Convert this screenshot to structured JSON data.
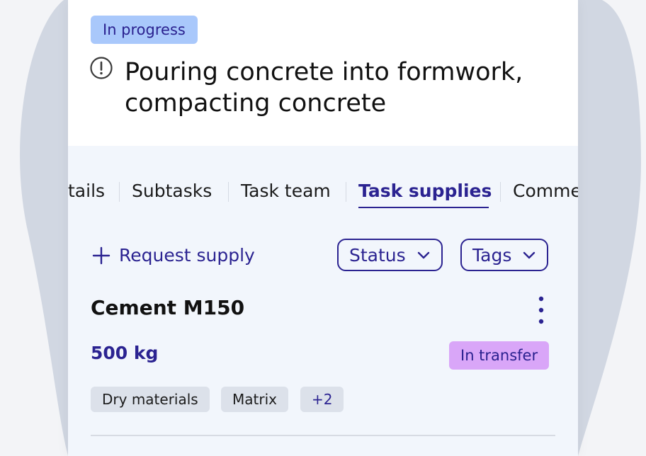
{
  "task": {
    "status": "In progress",
    "title": "Pouring concrete into formwork, compacting concrete"
  },
  "tabs": [
    {
      "label": "tails"
    },
    {
      "label": "Subtasks"
    },
    {
      "label": "Task team"
    },
    {
      "label": "Task supplies",
      "active": true
    },
    {
      "label": "Comme"
    }
  ],
  "toolbar": {
    "request_supply": "Request supply",
    "status_filter": "Status",
    "tags_filter": "Tags"
  },
  "supply": {
    "name": "Cement M150",
    "quantity": "500 kg",
    "status": "In transfer",
    "tags": [
      "Dry materials",
      "Matrix"
    ],
    "more_tags": "+2"
  },
  "colors": {
    "accent": "#2b2391",
    "progress_badge": "#a9c8fb",
    "transfer_badge": "#d9a6f8",
    "tag_bg": "#dce1ea"
  },
  "icons": {
    "alert": "alert-circle-icon",
    "plus": "plus-icon",
    "chevron": "chevron-down-icon",
    "more": "more-vertical-icon"
  }
}
